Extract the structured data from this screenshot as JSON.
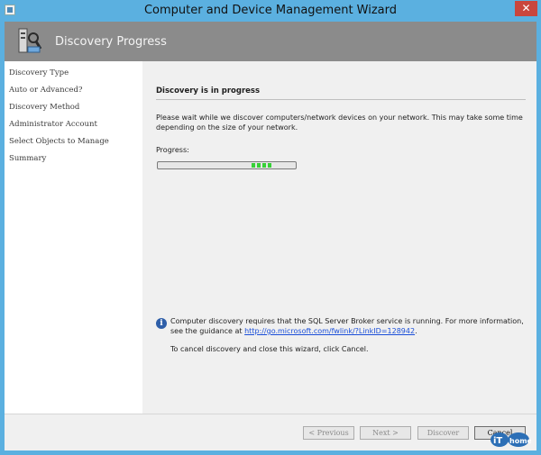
{
  "window": {
    "title": "Computer and Device Management Wizard",
    "close_glyph": "✕"
  },
  "banner": {
    "title": "Discovery Progress",
    "icon": "wizard-discovery-icon"
  },
  "sidebar": {
    "items": [
      {
        "label": "Discovery Type"
      },
      {
        "label": "Auto or Advanced?"
      },
      {
        "label": "Discovery Method"
      },
      {
        "label": "Administrator Account"
      },
      {
        "label": "Select Objects to Manage"
      },
      {
        "label": "Summary"
      }
    ]
  },
  "main": {
    "heading": "Discovery is in progress",
    "description": "Please wait while we discover computers/network devices on your network. This may take some time depending on the size of your network.",
    "progress_label": "Progress:",
    "info_text": "Computer discovery requires that the SQL Server Broker service is running. For more information, see the guidance at",
    "info_link": "http://go.microsoft.com/fwlink/?LinkID=128942",
    "info_end": ".",
    "cancel_hint": "To cancel discovery and close this wizard, click Cancel."
  },
  "footer": {
    "previous_label": "< Previous",
    "next_label": "Next >",
    "discover_label": "Discover",
    "cancel_label": "Cancel"
  },
  "watermark": {
    "text": "iThome"
  },
  "colors": {
    "titlebar": "#5bb0e0",
    "banner": "#8b8b8b",
    "progress": "#37d037",
    "close": "#c9463d",
    "link": "#1a4ed8"
  }
}
